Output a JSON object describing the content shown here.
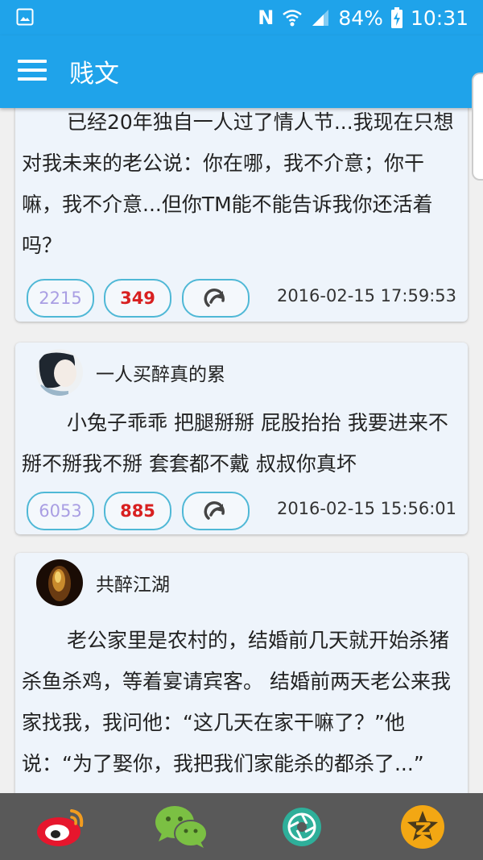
{
  "status_bar": {
    "nfc": "N",
    "battery": "84%",
    "time": "10:31"
  },
  "app_bar": {
    "title": "贱文"
  },
  "feed": [
    {
      "content": "已经20年独自一人过了情人节...我现在只想对我未来的老公说：你在哪，我不介意；你干嘛，我不介意...但你TM能不能告诉我你还活着吗？",
      "likes": "2215",
      "dislikes": "349",
      "time": "2016-02-15 17:59:53"
    },
    {
      "author": "一人买醉真的累",
      "content": "小兔子乖乖 把腿掰掰 屁股抬抬 我要进来不掰不掰我不掰 套套都不戴 叔叔你真坏",
      "likes": "6053",
      "dislikes": "885",
      "time": "2016-02-15 15:56:01"
    },
    {
      "author": "共醉江湖",
      "content": "老公家里是农村的，结婚前几天就开始杀猪杀鱼杀鸡，等着宴请宾客。 结婚前两天老公来我家找我，我问他：“这几天在家干嘛了？”他说：“为了娶你，我把我们家能杀的都杀了...”"
    }
  ],
  "share_bar": [
    {
      "icon": "weibo-icon",
      "color": "#e6162d"
    },
    {
      "icon": "wechat-icon",
      "color": "#7bc043"
    },
    {
      "icon": "moments-icon",
      "color": "#2eaf9a"
    },
    {
      "icon": "qzone-icon",
      "color": "#f3a713"
    }
  ]
}
